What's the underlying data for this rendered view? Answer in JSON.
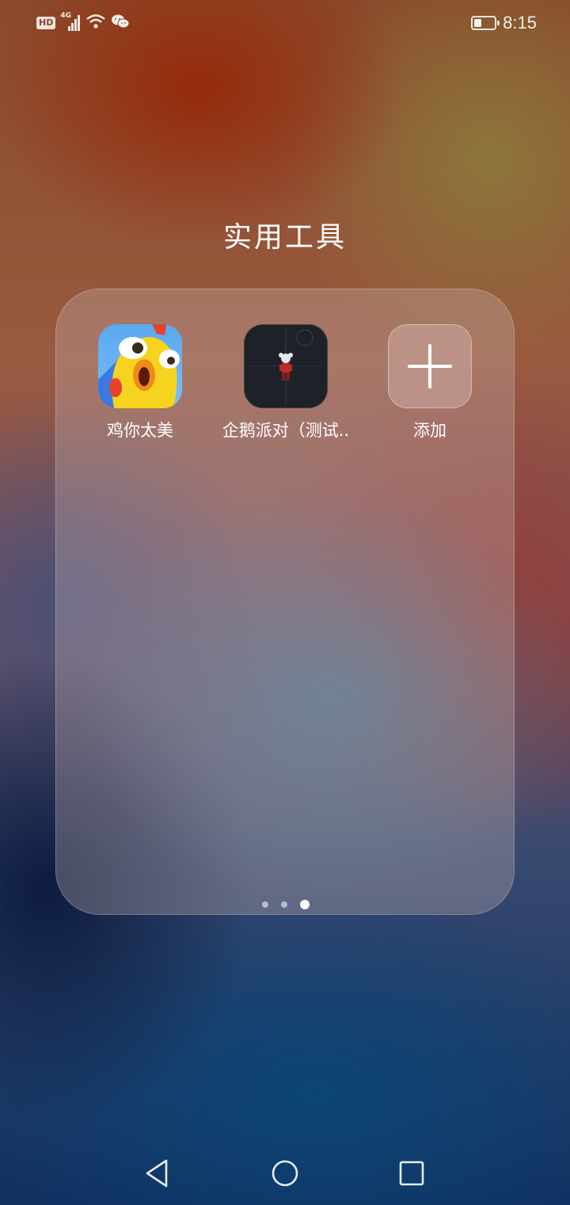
{
  "status_bar": {
    "hd_label": "HD",
    "network_label": "4G",
    "time": "8:15",
    "battery_level_percent": 40,
    "icons": [
      "hd-icon",
      "signal-icon",
      "wifi-icon",
      "wechat-icon",
      "battery-icon"
    ]
  },
  "folder": {
    "title": "实用工具",
    "apps": [
      {
        "label": "鸡你太美",
        "icon": "chicken-game-icon"
      },
      {
        "label": "企鹅派对（测试..",
        "icon": "penguin-party-icon"
      },
      {
        "label": "添加",
        "icon": "plus-icon"
      }
    ],
    "pages": {
      "count": 3,
      "active_index": 2
    }
  },
  "nav_bar": {
    "icons": [
      "back-triangle-icon",
      "home-circle-icon",
      "recent-square-icon"
    ]
  },
  "colors": {
    "text": "#ffffff",
    "penguin_icon_bg": "#1e2228",
    "chicken_icon_sky": "#5aa8f0"
  }
}
